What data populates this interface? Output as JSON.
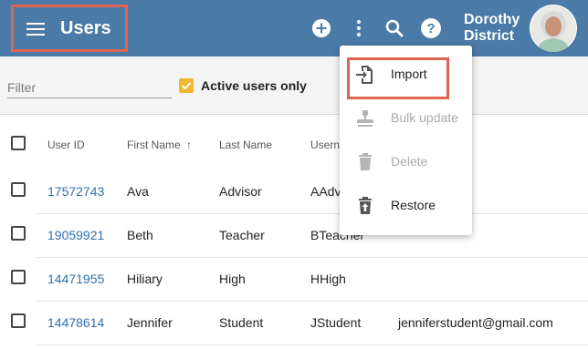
{
  "header": {
    "title": "Users",
    "user_name_line1": "Dorothy",
    "user_name_line2": "District",
    "icons": [
      "menu-icon",
      "add-circle-icon",
      "more-vert-icon",
      "search-icon",
      "help-icon",
      "avatar"
    ],
    "colors": {
      "header_bg": "#4a7aa6",
      "highlight": "#e06450"
    }
  },
  "filter": {
    "placeholder": "Filter",
    "value": "",
    "active_only_label": "Active users only",
    "active_only_checked": true,
    "checkbox_color": "#f2b632"
  },
  "table": {
    "columns": [
      "User ID",
      "First Name",
      "Last Name",
      "Usern"
    ],
    "sort_indicator": "↑",
    "rows": [
      {
        "user_id": "17572743",
        "first_name": "Ava",
        "last_name": "Advisor",
        "username": "AAdv",
        "email": ""
      },
      {
        "user_id": "19059921",
        "first_name": "Beth",
        "last_name": "Teacher",
        "username": "BTeacher",
        "email": ""
      },
      {
        "user_id": "14471955",
        "first_name": "Hiliary",
        "last_name": "High",
        "username": "HHigh",
        "email": ""
      },
      {
        "user_id": "14478614",
        "first_name": "Jennifer",
        "last_name": "Student",
        "username": "JStudent",
        "email": "jenniferstudent@gmail.com"
      }
    ]
  },
  "menu": {
    "items": [
      {
        "label": "Import",
        "icon": "import-icon",
        "enabled": true
      },
      {
        "label": "Bulk update",
        "icon": "stamp-icon",
        "enabled": false
      },
      {
        "label": "Delete",
        "icon": "delete-icon",
        "enabled": false
      },
      {
        "label": "Restore",
        "icon": "restore-icon",
        "enabled": true
      }
    ]
  }
}
